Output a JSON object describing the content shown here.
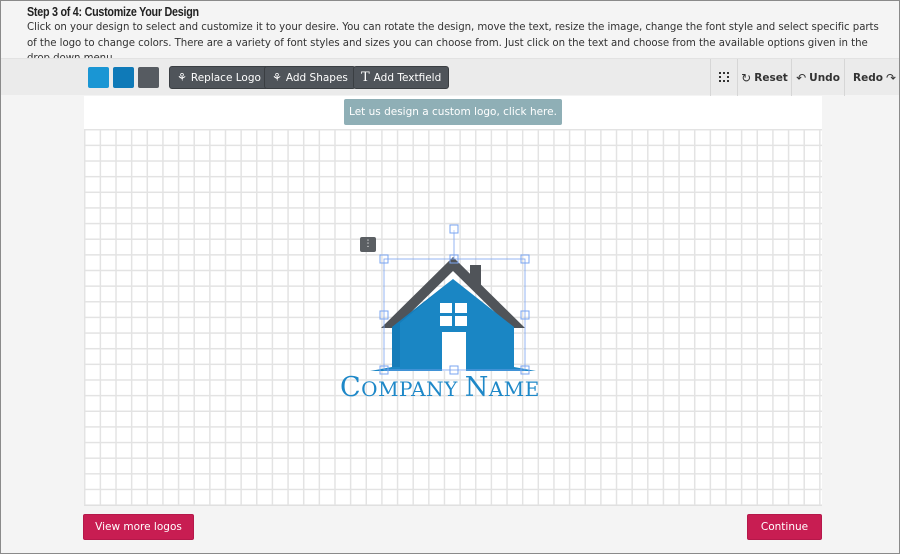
{
  "header": {
    "step_title": "Step 3 of 4: Customize Your Design",
    "description": "Click on your design to select and customize it to your desire. You can rotate the design, move the text, resize the image, change the font style and select specific parts of the logo to change colors. There are a variety of font styles and sizes you can choose from. Just click on the text and choose from the available options given in the drop down menu."
  },
  "toolbar": {
    "color_swatches": [
      {
        "name": "light-blue",
        "color": "#1a96d4"
      },
      {
        "name": "dark-blue",
        "color": "#0f7ab8"
      },
      {
        "name": "gray",
        "color": "#565b61"
      }
    ],
    "buttons": [
      {
        "label": "Replace Logo",
        "icon": "shapes-icon"
      },
      {
        "label": "Add Shapes",
        "icon": "shapes-icon"
      },
      {
        "label": "Add Textfield",
        "icon": "text-icon"
      }
    ],
    "grid_toggle_icon": "grid-dots-icon",
    "reset_label": "Reset",
    "undo_label": "Undo",
    "redo_label": "Redo"
  },
  "canvas": {
    "custom_logo_button": "Let us design a custom logo, click here.",
    "company_name": {
      "first_initial": "C",
      "first_rest": "ompany",
      "second_initial": "N",
      "second_rest": "ame"
    },
    "logo_colors": {
      "roof": "#505459",
      "house": "#1a86c4",
      "house_dark": "#0f72ad",
      "window": "#ffffff",
      "selection": "#7aa4f0"
    },
    "context_menu_icon": "vertical-dots-icon"
  },
  "footer": {
    "view_more_label": "View more logos",
    "continue_label": "Continue"
  }
}
